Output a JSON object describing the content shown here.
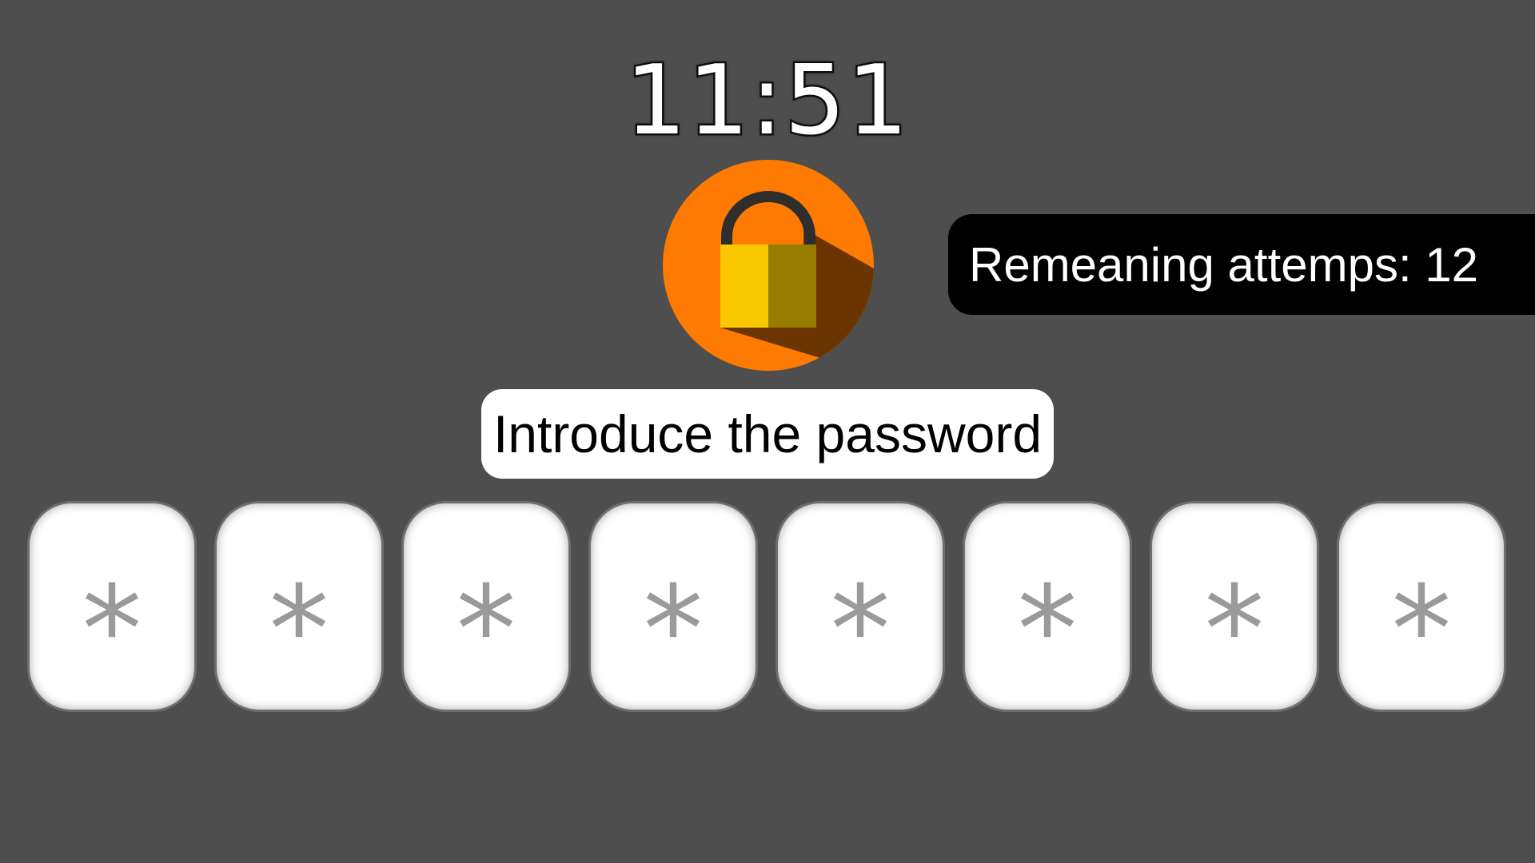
{
  "clock": {
    "time": "11:51"
  },
  "lock": {
    "icon": "padlock-icon",
    "colors": {
      "badge": "#ff7a00",
      "shadow": "#6a3500",
      "shackle": "#2e2e2e",
      "body_light": "#f9c800",
      "body_dark": "#967d00"
    }
  },
  "attempts": {
    "text": "Remeaning attemps: 12"
  },
  "prompt": {
    "text": "Introduce the password"
  },
  "password": {
    "length": 8,
    "slots": [
      {
        "char": "*"
      },
      {
        "char": "*"
      },
      {
        "char": "*"
      },
      {
        "char": "*"
      },
      {
        "char": "*"
      },
      {
        "char": "*"
      },
      {
        "char": "*"
      },
      {
        "char": "*"
      }
    ]
  }
}
